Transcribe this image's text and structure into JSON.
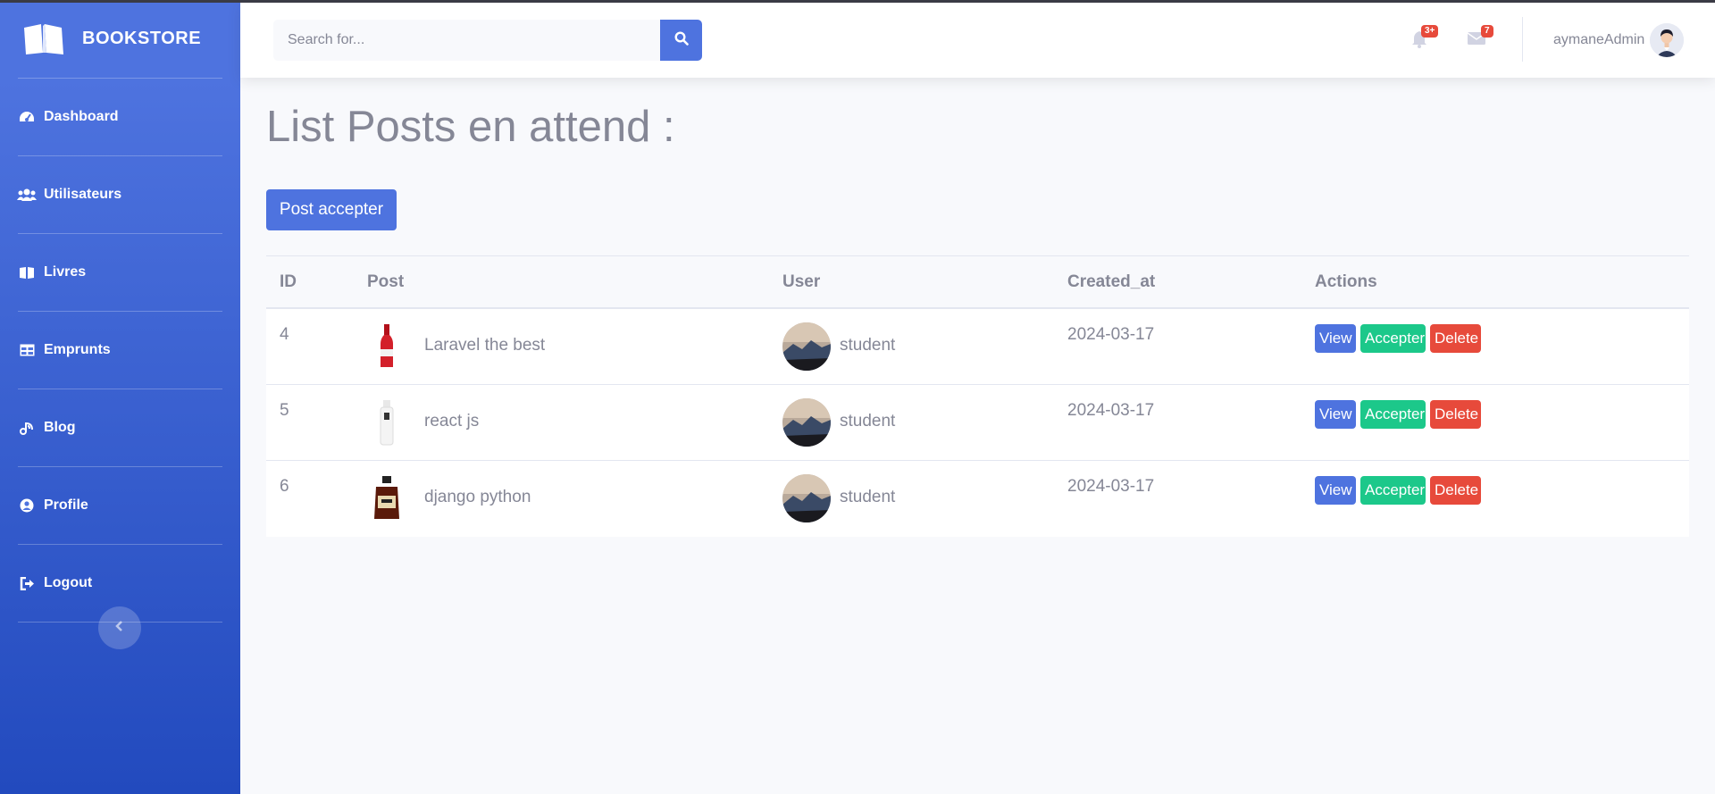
{
  "brand": {
    "name": "BOOKSTORE"
  },
  "sidebar": {
    "items": [
      {
        "label": "Dashboard",
        "icon": "dashboard-icon"
      },
      {
        "label": "Utilisateurs",
        "icon": "users-icon"
      },
      {
        "label": "Livres",
        "icon": "book-icon"
      },
      {
        "label": "Emprunts",
        "icon": "table-icon"
      },
      {
        "label": "Blog",
        "icon": "blog-icon"
      },
      {
        "label": "Profile",
        "icon": "user-circle-icon"
      },
      {
        "label": "Logout",
        "icon": "logout-icon"
      }
    ]
  },
  "topbar": {
    "search_placeholder": "Search for...",
    "alerts_badge": "3+",
    "messages_badge": "7",
    "user_name": "aymaneAdmin"
  },
  "page": {
    "title": "List Posts en attend :",
    "primary_button": "Post accepter"
  },
  "table": {
    "headers": [
      "ID",
      "Post",
      "User",
      "Created_at",
      "Actions"
    ],
    "rows": [
      {
        "id": "4",
        "post": "Laravel the best",
        "user": "student",
        "created_at": "2024-03-17",
        "post_image": "red-bottle"
      },
      {
        "id": "5",
        "post": "react js",
        "user": "student",
        "created_at": "2024-03-17",
        "post_image": "white-bottle"
      },
      {
        "id": "6",
        "post": "django python",
        "user": "student",
        "created_at": "2024-03-17",
        "post_image": "whiskey-bottle"
      }
    ],
    "actions": {
      "view": "View",
      "accept": "Accepter",
      "delete": "Delete"
    }
  },
  "colors": {
    "primary": "#4e73df",
    "success": "#1cc88a",
    "danger": "#e74a3b",
    "text_muted": "#858796"
  }
}
